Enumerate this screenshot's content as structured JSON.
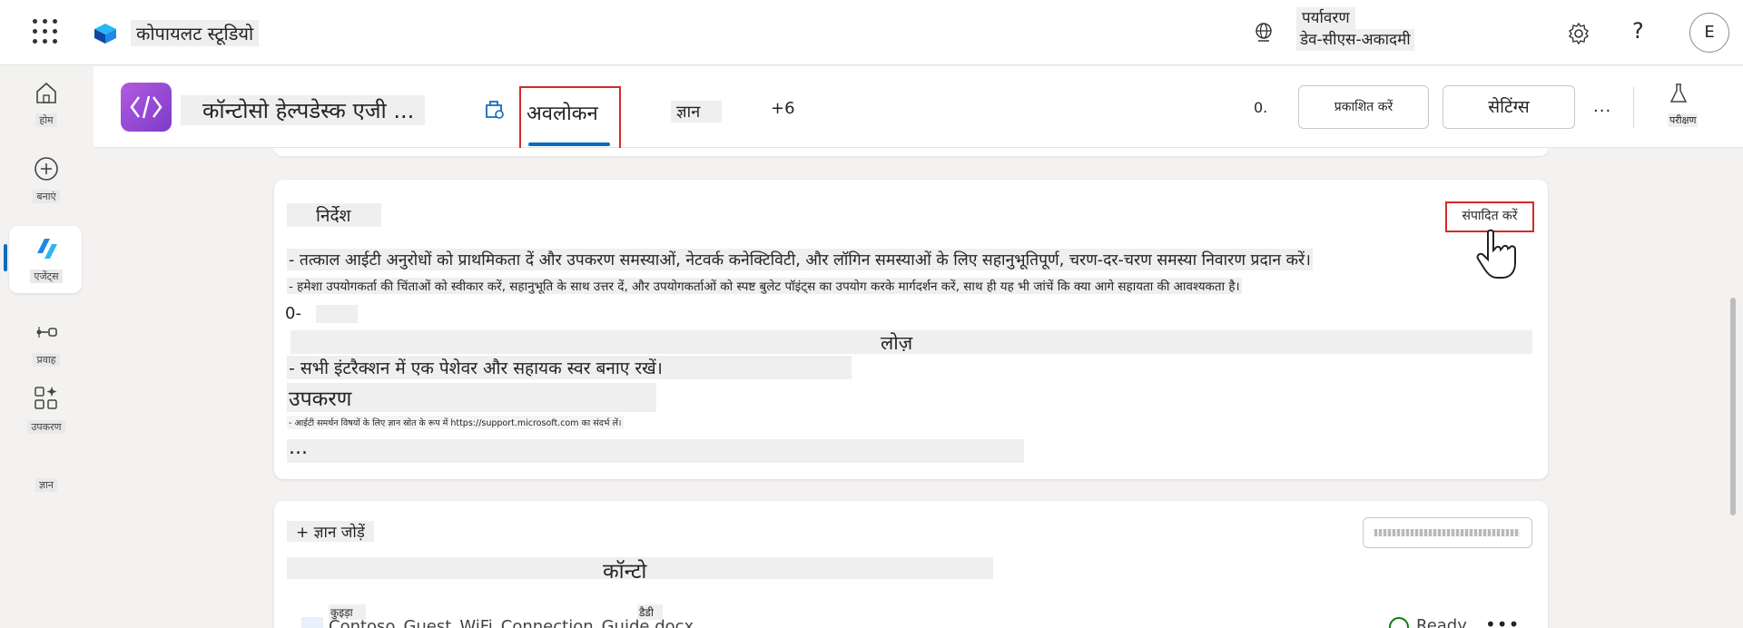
{
  "topbar": {
    "app_title": "कोपायलट स्टूडियो",
    "env_label": "पर्यावरण",
    "env_name": "डेव-सीएस-अकादमी",
    "avatar_initial": "E",
    "help_glyph": "?"
  },
  "rail": {
    "items": [
      {
        "label": "होम"
      },
      {
        "label": "बनाएं"
      },
      {
        "label": "एजेंट्स"
      },
      {
        "label": "प्रवाह"
      },
      {
        "label": "उपकरण"
      },
      {
        "label": "ज्ञान"
      }
    ]
  },
  "header": {
    "agent_name": "कॉन्टोसो हेल्पडेस्क एजी ...",
    "tabs": {
      "overview": "अवलोकन",
      "knowledge": "ज्ञान",
      "more": "+6"
    },
    "indicator": "0.",
    "publish_label": "प्रकाशित करें",
    "settings_label": "सेटिंग्स",
    "more_label": "...",
    "test_label": "परीक्षण"
  },
  "instructions": {
    "title": "निर्देश",
    "edit_label": "संपादित करें",
    "lines": [
      "- तत्काल आईटी अनुरोधों को प्राथमिकता दें और उपकरण समस्याओं, नेटवर्क कनेक्टिविटी, और लॉगिन समस्याओं के लिए सहानुभूतिपूर्ण, चरण-दर-चरण समस्या निवारण प्रदान करें।",
      "- हमेशा उपयोगकर्ता की चिंताओं को स्वीकार करें, सहानुभूति के साथ उत्तर दें, और उपयोगकर्ताओं को स्पष्ट बुलेट पॉइंट्स का उपयोग करके मार्गदर्शन करें, साथ ही यह भी जांचें कि क्या आगे सहायता की आवश्यकता है।",
      "0-",
      "लोज़",
      "- सभी इंटरैक्शन में एक पेशेवर और सहायक स्वर बनाए रखें।",
      "उपकरण",
      "- आईटी समर्थन विषयों के लिए ज्ञान स्रोत के रूप में https://support.microsoft.com का संदर्भ लें।",
      "..."
    ]
  },
  "knowledge": {
    "add_label": "+ ज्ञान जोड़ें",
    "heading": "कॉन्टो",
    "file": {
      "tag1": "कुइड़ा",
      "name": "Contoso_Guest_WiFi_Connection_Guide.docx",
      "tag2": "डैडी",
      "status": "Ready"
    }
  },
  "colors": {
    "accent": "#0f6cbd",
    "highlight_box": "#d42a2a",
    "agent_icon": "#9b4bd8",
    "ready": "#107c10"
  }
}
